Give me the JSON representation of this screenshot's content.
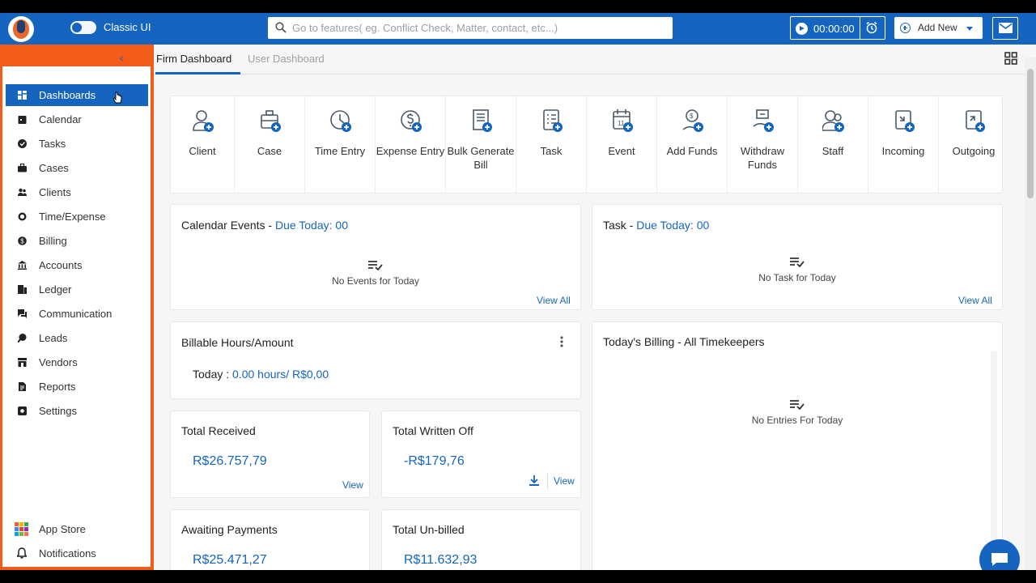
{
  "topbar": {
    "toggle_label": "Classic UI",
    "search_placeholder": "Go to features( eg. Conflict Check, Matter, contact, etc...)",
    "timer": "00:00:00",
    "add_new": "Add New"
  },
  "sidebar": {
    "items": [
      {
        "label": "Dashboards",
        "icon": "dashboard-icon"
      },
      {
        "label": "Calendar",
        "icon": "calendar-icon"
      },
      {
        "label": "Tasks",
        "icon": "check-circle-icon"
      },
      {
        "label": "Cases",
        "icon": "briefcase-icon"
      },
      {
        "label": "Clients",
        "icon": "people-icon"
      },
      {
        "label": "Time/Expense",
        "icon": "clock-icon"
      },
      {
        "label": "Billing",
        "icon": "dollar-icon"
      },
      {
        "label": "Accounts",
        "icon": "bank-icon"
      },
      {
        "label": "Ledger",
        "icon": "ledger-icon"
      },
      {
        "label": "Communication",
        "icon": "chat-icon"
      },
      {
        "label": "Leads",
        "icon": "leads-icon"
      },
      {
        "label": "Vendors",
        "icon": "store-icon"
      },
      {
        "label": "Reports",
        "icon": "report-icon"
      },
      {
        "label": "Settings",
        "icon": "settings-icon"
      }
    ],
    "app_store": "App Store",
    "notifications": "Notifications"
  },
  "tabs": {
    "firm": "Firm Dashboard",
    "user": "User Dashboard"
  },
  "quick_actions": [
    "Client",
    "Case",
    "Time Entry",
    "Expense Entry",
    "Bulk Generate Bill",
    "Task",
    "Event",
    "Add Funds",
    "Withdraw Funds",
    "Staff",
    "Incoming",
    "Outgoing"
  ],
  "calendar_card": {
    "title": "Calendar Events - ",
    "due": "Due Today: 00",
    "empty": "No Events for Today",
    "view_all": "View All"
  },
  "task_card": {
    "title": "Task - ",
    "due": "Due Today: 00",
    "empty": "No Task for Today",
    "view_all": "View All"
  },
  "billable_card": {
    "title": "Billable Hours/Amount",
    "today_label": "Today : ",
    "today_value": "0.00 hours/ R$0,00"
  },
  "billing_card": {
    "title": "Today's Billing - All Timekeepers",
    "empty": "No Entries For Today"
  },
  "total_received": {
    "title": "Total Received",
    "value": "R$26.757,79",
    "link": "View"
  },
  "total_written_off": {
    "title": "Total Written Off",
    "value": "-R$179,76",
    "link": "View"
  },
  "awaiting_payments": {
    "title": "Awaiting Payments",
    "value": "R$25.471,27"
  },
  "total_unbilled": {
    "title": "Total Un-billed",
    "value": "R$11.632,93"
  },
  "colors": {
    "brand": "#1565c0",
    "highlight_border": "#f25c18"
  }
}
